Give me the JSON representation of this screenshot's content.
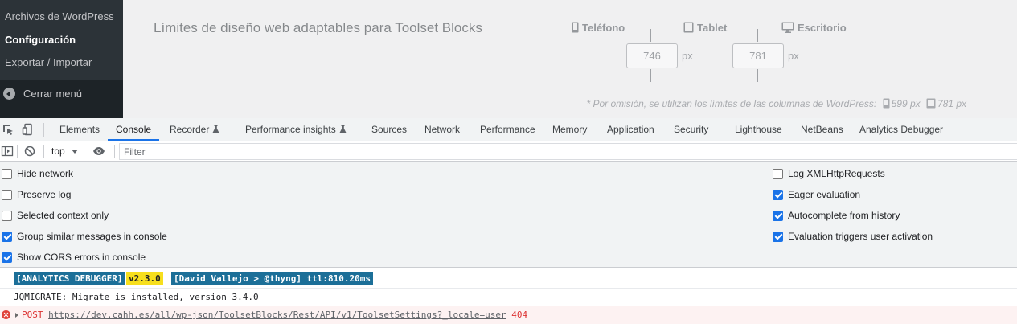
{
  "wp": {
    "submenu": [
      "Archivos de WordPress",
      "Configuración",
      "Exportar / Importar"
    ],
    "current_submenu": "Configuración",
    "collapse_label": "Cerrar menú",
    "section_title": "Límites de diseño web adaptables para Toolset Blocks",
    "devices": {
      "phone": "Teléfono",
      "tablet": "Tablet",
      "desktop": "Escritorio"
    },
    "breakpoints": {
      "phone_tablet": "746",
      "tablet_desktop": "781",
      "unit": "px"
    },
    "note": {
      "text": "* Por omisión, se utilizan los límites de las columnas de WordPress:",
      "phone_value": "599 px",
      "tablet_value": "781 px"
    }
  },
  "devtools": {
    "tabs": [
      {
        "label": "Elements"
      },
      {
        "label": "Console",
        "active": true
      },
      {
        "label": "Recorder",
        "experimental": true
      },
      {
        "label": "Performance insights",
        "experimental": true
      },
      {
        "label": "Sources"
      },
      {
        "label": "Network"
      },
      {
        "label": "Performance"
      },
      {
        "label": "Memory"
      },
      {
        "label": "Application"
      },
      {
        "label": "Security"
      },
      {
        "label": "Lighthouse"
      },
      {
        "label": "NetBeans"
      },
      {
        "label": "Analytics Debugger"
      }
    ],
    "toolbar": {
      "context": "top",
      "filter_placeholder": "Filter"
    },
    "settings_left": [
      {
        "label": "Hide network",
        "checked": false
      },
      {
        "label": "Preserve log",
        "checked": false
      },
      {
        "label": "Selected context only",
        "checked": false
      },
      {
        "label": "Group similar messages in console",
        "checked": true
      },
      {
        "label": "Show CORS errors in console",
        "checked": true
      }
    ],
    "settings_right": [
      {
        "label": "Log XMLHttpRequests",
        "checked": false
      },
      {
        "label": "Eager evaluation",
        "checked": true
      },
      {
        "label": "Autocomplete from history",
        "checked": true
      },
      {
        "label": "Evaluation triggers user activation",
        "checked": true
      }
    ],
    "messages": {
      "analytics": {
        "name": "[ANALYTICS DEBUGGER]",
        "version": "v2.3.0",
        "author": "[David Vallejo > @thyng] ttl:810.20ms"
      },
      "jqmigrate": "JQMIGRATE: Migrate is installed, version 3.4.0",
      "error": {
        "method": "POST",
        "url": "https://dev.cahh.es/all/wp-json/ToolsetBlocks/Rest/API/v1/ToolsetSettings?_locale=user",
        "status": "404"
      }
    },
    "colors": {
      "accent": "#1a73e8",
      "badge_blue": "#1c6f98",
      "badge_yellow": "#f7df1e",
      "error": "#dc3232"
    }
  }
}
